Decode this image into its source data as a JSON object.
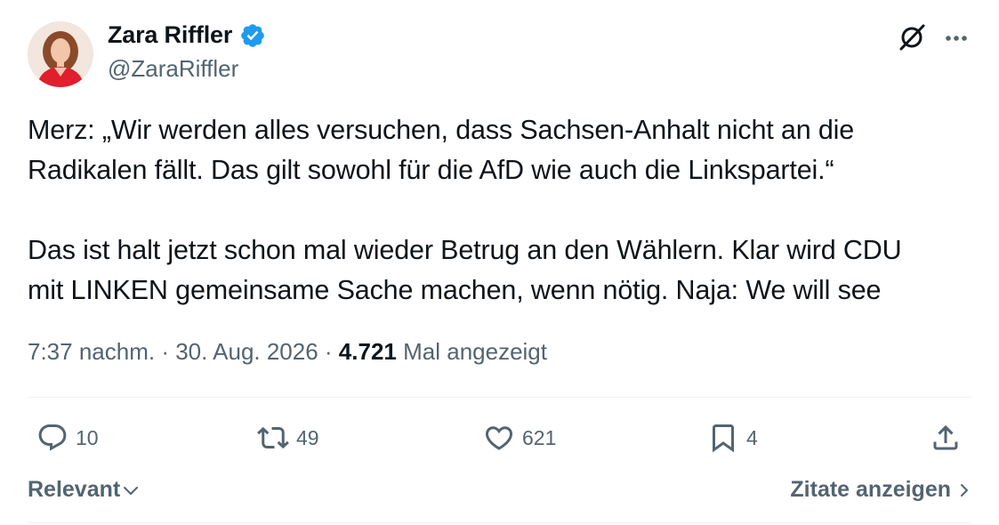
{
  "author": {
    "name": "Zara Riffler",
    "handle": "@ZaraRiffler",
    "verified_icon": "verified-badge-icon"
  },
  "header_icons": {
    "grok": "grok-icon",
    "more": "more-dots-icon"
  },
  "tweet": {
    "lines_para1": [
      "Merz: „Wir werden alles versuchen, dass Sachsen-Anhalt nicht an die",
      "Radikalen fällt. Das gilt sowohl für die AfD wie auch die Linkspartei.“"
    ],
    "lines_para2": [
      "Das ist halt jetzt schon mal wieder Betrug an den Wählern. Klar wird CDU",
      "mit LINKEN gemeinsame Sache machen, wenn nötig. Naja: We will see"
    ]
  },
  "meta": {
    "time": "7:37 nachm.",
    "sep": " · ",
    "date": "30. Aug. 2026",
    "views_count": "4.721",
    "views_label": "Mal angezeigt"
  },
  "actions": {
    "replies": "10",
    "reposts": "49",
    "likes": "621",
    "bookmarks": "4"
  },
  "footer": {
    "sort_label": "Relevant",
    "quotes_label": "Zitate anzeigen"
  },
  "colors": {
    "text": "#0f1419",
    "secondary": "#536471",
    "verified": "#1d9bf0",
    "divider": "#eff3f4"
  }
}
